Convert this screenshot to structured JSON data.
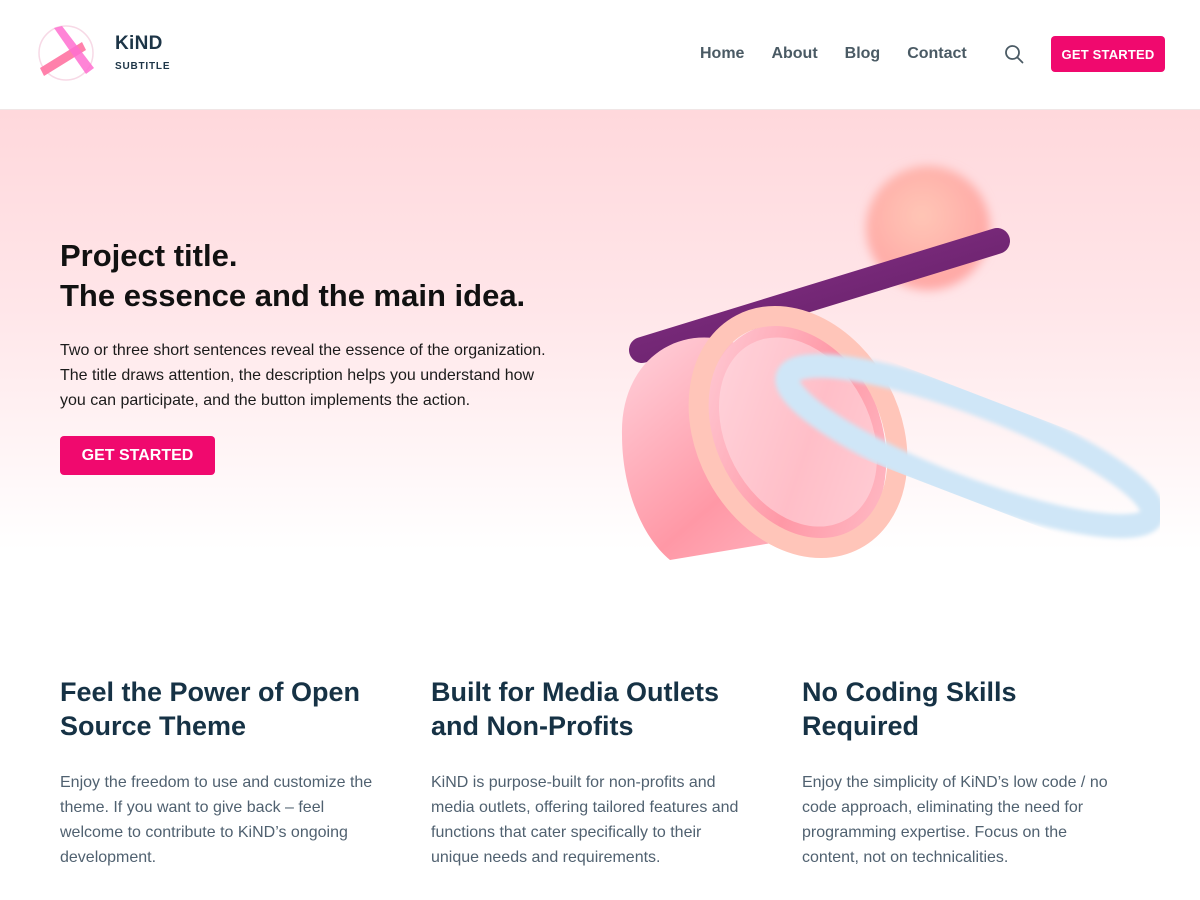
{
  "header": {
    "brand_name": "KiND",
    "brand_subtitle": "SUBTITLE",
    "nav": [
      "Home",
      "About",
      "Blog",
      "Contact"
    ],
    "search_icon": "search-icon",
    "cta_label": "GET STARTED"
  },
  "hero": {
    "title_line1": "Project title.",
    "title_line2": "The essence and the main idea.",
    "desc_line1": "Two or three short sentences reveal the essence of the organization.",
    "desc_line2": "The title draws attention, the description helps you understand how",
    "desc_line3": "you can participate, and the button implements the action.",
    "cta_label": "GET STARTED"
  },
  "features": [
    {
      "title_line1": "Feel the Power of Open",
      "title_line2": "Source Theme",
      "text_lines": [
        "Enjoy the freedom to use and customize the",
        "theme. If you want to give back – feel",
        "welcome to contribute to KiND’s ongoing",
        "development."
      ]
    },
    {
      "title_line1": "Built for Media Outlets",
      "title_line2": "and Non-Profits",
      "text_lines": [
        "KiND is purpose-built for non-profits and",
        "media outlets, offering tailored features and",
        "functions that cater specifically to their",
        "unique needs and requirements."
      ]
    },
    {
      "title_line1": "No Coding Skills",
      "title_line2": "Required",
      "text_lines": [
        "Enjoy the simplicity of KiND’s low code / no",
        "code approach, eliminating the need for",
        "programming expertise. Focus on the",
        "content, not on technicalities."
      ]
    }
  ],
  "colors": {
    "accent": "#f0096e",
    "heading": "#163245",
    "body_text": "#506170",
    "hero_bg_top": "#ffd8dc"
  }
}
